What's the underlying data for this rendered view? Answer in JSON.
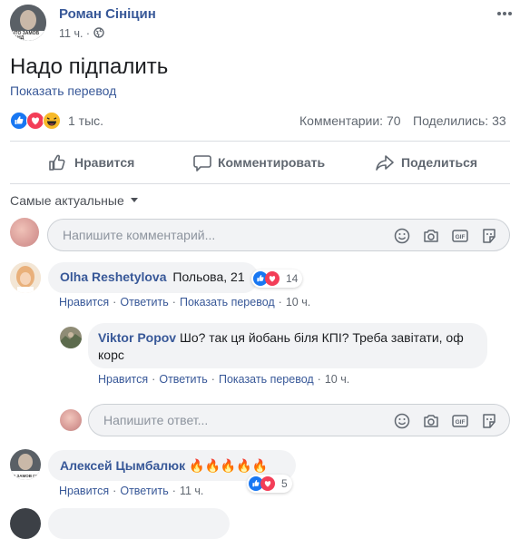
{
  "post": {
    "author": "Роман Сініцин",
    "time": "11 ч.",
    "text": "Надо підпалить",
    "translate_link": "Показать перевод",
    "reactions_count": "1 тыс.",
    "comments_count": "Комментарии: 70",
    "shares_count": "Поделились: 33"
  },
  "actions": {
    "like": "Нравится",
    "comment": "Комментировать",
    "share": "Поделиться"
  },
  "sort_label": "Самые актуальные",
  "comment_input_placeholder": "Напишите комментарий...",
  "reply_input_placeholder": "Напишите ответ...",
  "comments": [
    {
      "author": "Olha Reshetylova",
      "text": "Польова, 21",
      "reactions": "14",
      "like": "Нравится",
      "reply": "Ответить",
      "translate": "Показать перевод",
      "time": "10 ч.",
      "replies": [
        {
          "author": "Viktor Popov",
          "text": "Шо? так ця йобань біля КПІ? Треба завітати, оф корс",
          "like": "Нравится",
          "reply": "Ответить",
          "translate": "Показать перевод",
          "time": "10 ч."
        }
      ]
    },
    {
      "author": "Алексей Цымбалюк",
      "text": "🔥🔥🔥🔥🔥",
      "reactions": "5",
      "like": "Нравится",
      "reply": "Ответить",
      "time": "11 ч."
    }
  ],
  "avatar_text": "ЧТО ЗАМОВ ГАНД"
}
